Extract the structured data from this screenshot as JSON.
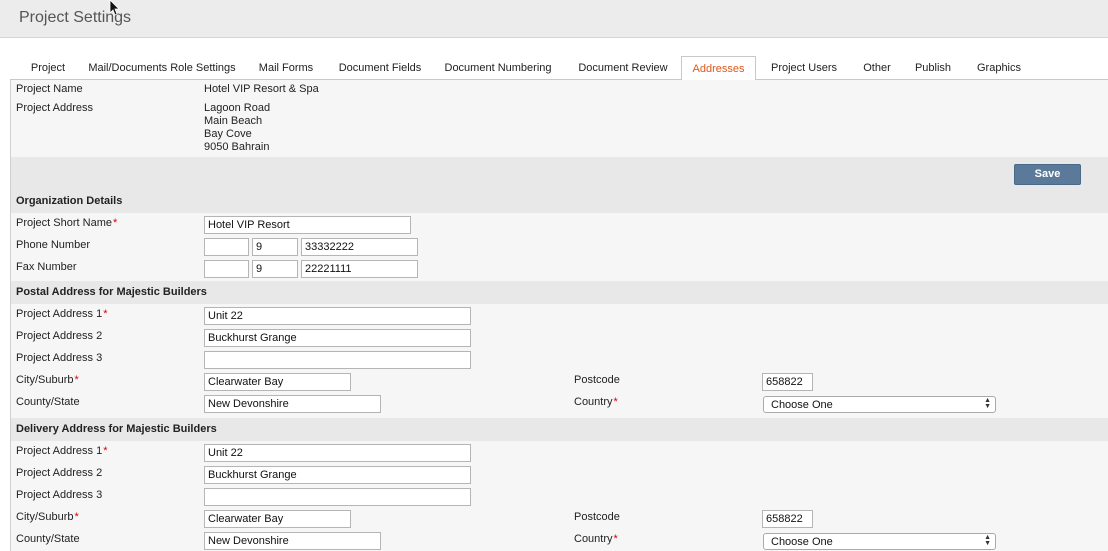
{
  "page_title": "Project Settings",
  "tabs": [
    {
      "label": "Project"
    },
    {
      "label": "Mail/Documents Role Settings"
    },
    {
      "label": "Mail Forms"
    },
    {
      "label": "Document Fields"
    },
    {
      "label": "Document Numbering"
    },
    {
      "label": "Document Review"
    },
    {
      "label": "Addresses"
    },
    {
      "label": "Project Users"
    },
    {
      "label": "Other"
    },
    {
      "label": "Publish"
    },
    {
      "label": "Graphics"
    }
  ],
  "active_tab": "Addresses",
  "colors": {
    "active_tab": "#e0561c",
    "save_button": "#5b7a99",
    "required_mark": "#dd0000"
  },
  "project_info": {
    "name_label": "Project Name",
    "name_value": "Hotel VIP Resort & Spa",
    "address_label": "Project Address",
    "address_lines": [
      "Lagoon Road",
      "Main Beach",
      "Bay Cove",
      "9050 Bahrain"
    ]
  },
  "save_label": "Save",
  "org": {
    "title": "Organization Details",
    "short_name_label": "Project Short Name",
    "short_name_value": "Hotel VIP Resort",
    "phone_label": "Phone Number",
    "phone": [
      "",
      "9",
      "33332222"
    ],
    "fax_label": "Fax Number",
    "fax": [
      "",
      "9",
      "22221111"
    ]
  },
  "postal": {
    "title": "Postal Address for Majestic Builders",
    "addr1_label": "Project Address 1",
    "addr1_value": "Unit 22",
    "addr2_label": "Project Address 2",
    "addr2_value": "Buckhurst Grange",
    "addr3_label": "Project Address 3",
    "addr3_value": "",
    "city_label": "City/Suburb",
    "city_value": "Clearwater Bay",
    "postcode_label": "Postcode",
    "postcode_value": "658822",
    "state_label": "County/State",
    "state_value": "New Devonshire",
    "country_label": "Country",
    "country_value": "Choose One"
  },
  "delivery": {
    "title": "Delivery Address for Majestic Builders",
    "addr1_label": "Project Address 1",
    "addr1_value": "Unit 22",
    "addr2_label": "Project Address 2",
    "addr2_value": "Buckhurst Grange",
    "addr3_label": "Project Address 3",
    "addr3_value": "",
    "city_label": "City/Suburb",
    "city_value": "Clearwater Bay",
    "postcode_label": "Postcode",
    "postcode_value": "658822",
    "state_label": "County/State",
    "state_value": "New Devonshire",
    "country_label": "Country",
    "country_value": "Choose One"
  }
}
